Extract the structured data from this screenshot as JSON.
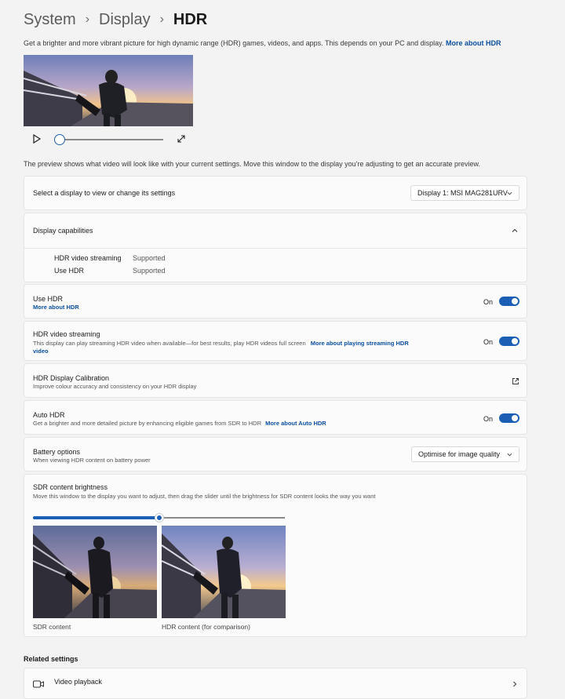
{
  "breadcrumb": {
    "items": [
      "System",
      "Display",
      "HDR"
    ]
  },
  "intro": {
    "text": "Get a brighter and more vibrant picture for high dynamic range (HDR) games, videos, and apps. This depends on your PC and display.",
    "link": "More about HDR"
  },
  "preview": {
    "note": "The preview shows what video will look like with your current settings. Move this window to the display you're adjusting to get an accurate preview.",
    "progress": 0.05
  },
  "select_display": {
    "label": "Select a display to view or change its settings",
    "value": "Display 1: MSI MAG281URV"
  },
  "capabilities": {
    "title": "Display capabilities",
    "rows": [
      {
        "name": "HDR video streaming",
        "status": "Supported"
      },
      {
        "name": "Use HDR",
        "status": "Supported"
      }
    ]
  },
  "use_hdr": {
    "title": "Use HDR",
    "link": "More about HDR",
    "state": "On"
  },
  "hdr_streaming": {
    "title": "HDR video streaming",
    "subtitle": "This display can play streaming HDR video when available—for best results, play HDR videos full screen",
    "link_line1": "More about playing streaming HDR",
    "link_line2": "video",
    "state": "On"
  },
  "calibration": {
    "title": "HDR Display Calibration",
    "subtitle": "Improve colour accuracy and consistency on your HDR display"
  },
  "auto_hdr": {
    "title": "Auto HDR",
    "subtitle": "Get a brighter and more detailed picture by enhancing eligible games from SDR to HDR",
    "link": "More about Auto HDR",
    "state": "On"
  },
  "battery": {
    "title": "Battery options",
    "subtitle": "When viewing HDR content on battery power",
    "value": "Optimise for image quality"
  },
  "sdr_brightness": {
    "title": "SDR content brightness",
    "subtitle": "Move this window to the display you want to adjust, then drag the slider until the brightness for SDR content looks the way you want",
    "level": 0.5,
    "sdr_caption": "SDR content",
    "hdr_caption": "HDR content (for comparison)"
  },
  "related": {
    "heading": "Related settings",
    "item": "Video playback"
  },
  "colors": {
    "accent": "#1a5fb4",
    "link": "#0a4f9e"
  }
}
